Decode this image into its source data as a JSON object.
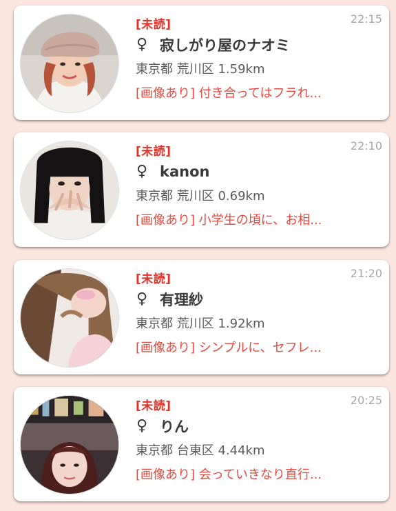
{
  "colors": {
    "background": "#fbe5df",
    "unread": "#e1322a",
    "message": "#e4483f",
    "time": "#a6a6a6"
  },
  "messages": [
    {
      "unread_label": "[未読]",
      "time": "22:15",
      "gender_icon": "female-sign-icon",
      "gender_symbol": "♀",
      "name": "寂しがり屋のナオミ",
      "location": "東京都 荒川区 1.59km",
      "preview": "[画像あり] 付き合ってはフラれ..."
    },
    {
      "unread_label": "[未読]",
      "time": "22:10",
      "gender_icon": "female-sign-icon",
      "gender_symbol": "♀",
      "name": "kanon",
      "location": "東京都 荒川区 0.69km",
      "preview": "[画像あり] 小学生の頃に、お相..."
    },
    {
      "unread_label": "[未読]",
      "time": "21:20",
      "gender_icon": "female-sign-icon",
      "gender_symbol": "♀",
      "name": "有理紗",
      "location": "東京都 荒川区 1.92km",
      "preview": "[画像あり] シンプルに、セフレ..."
    },
    {
      "unread_label": "[未読]",
      "time": "20:25",
      "gender_icon": "female-sign-icon",
      "gender_symbol": "♀",
      "name": "りん",
      "location": "東京都 台東区 4.44km",
      "preview": "[画像あり] 会っていきなり直行..."
    }
  ]
}
